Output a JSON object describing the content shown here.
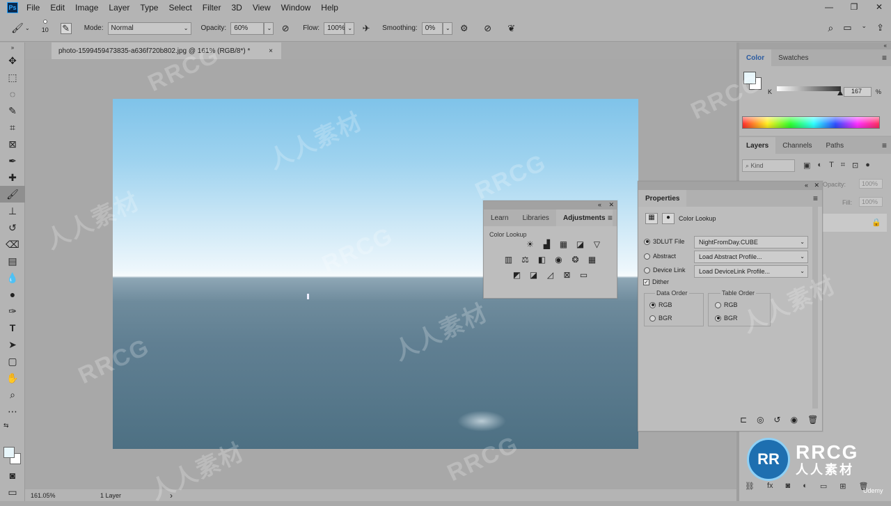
{
  "app": {
    "logo_text": "Ps",
    "menu": [
      "File",
      "Edit",
      "Image",
      "Layer",
      "Type",
      "Select",
      "Filter",
      "3D",
      "View",
      "Window",
      "Help"
    ]
  },
  "options_bar": {
    "brush_size": "10",
    "mode_label": "Mode:",
    "mode_value": "Normal",
    "opacity_label": "Opacity:",
    "opacity_value": "60%",
    "flow_label": "Flow:",
    "flow_value": "100%",
    "smoothing_label": "Smoothing:",
    "smoothing_value": "0%"
  },
  "document": {
    "tab_title": "photo-1599459473835-a636f720b802.jpg @ 161% (RGB/8*) *",
    "close": "×"
  },
  "status": {
    "zoom": "161.05%",
    "info": "1 Layer",
    "arrow": "›"
  },
  "color_panel": {
    "tabs": [
      "Color",
      "Swatches"
    ],
    "channel_label": "K",
    "channel_value": "167",
    "percent": "%"
  },
  "layers_panel": {
    "tabs": [
      "Layers",
      "Channels",
      "Paths"
    ],
    "filter_placeholder": "Kind",
    "opacity_label": "Opacity:",
    "opacity_value": "100%",
    "fill_label": "Fill:",
    "fill_value": "100%"
  },
  "adjustments_panel": {
    "tabs": [
      "Learn",
      "Libraries",
      "Adjustments"
    ],
    "hover_label": "Color Lookup"
  },
  "properties_panel": {
    "title": "Properties",
    "layer_type": "Color Lookup",
    "rows": [
      {
        "label": "3DLUT File",
        "value": "NightFromDay.CUBE",
        "selected": true
      },
      {
        "label": "Abstract",
        "value": "Load Abstract Profile...",
        "selected": false
      },
      {
        "label": "Device Link",
        "value": "Load DeviceLink Profile...",
        "selected": false
      }
    ],
    "dither_label": "Dither",
    "data_order": {
      "title": "Data Order",
      "options": [
        "RGB",
        "BGR"
      ],
      "selected": "RGB"
    },
    "table_order": {
      "title": "Table Order",
      "options": [
        "RGB",
        "BGR"
      ],
      "selected": "BGR"
    }
  },
  "watermark": {
    "brand": "RRCG",
    "chinese": "人人素材",
    "udemy": "Udemy"
  }
}
